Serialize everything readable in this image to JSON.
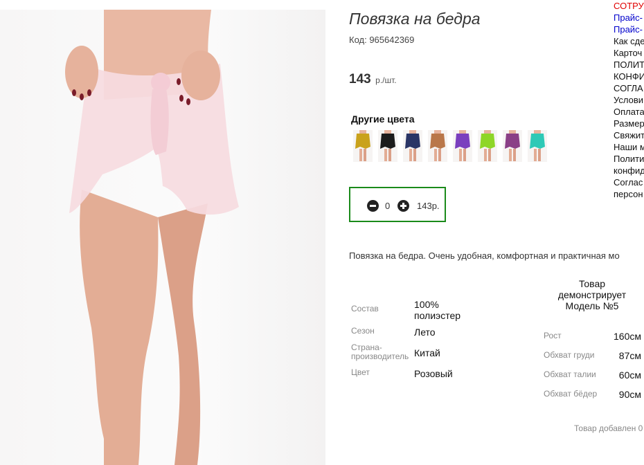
{
  "product": {
    "title": "Повязка на бедра",
    "code": "Код: 965642369",
    "price": "143",
    "price_unit": "р./шт.",
    "description": "Повязка на бедра. Очень удобная, комфортная и практичная мо"
  },
  "other_colors": {
    "title": "Другие цвета",
    "swatches": [
      {
        "name": "yellow",
        "color": "#c9a21c"
      },
      {
        "name": "black",
        "color": "#1c1c1c"
      },
      {
        "name": "navy",
        "color": "#2a3566"
      },
      {
        "name": "bronze",
        "color": "#b9774a"
      },
      {
        "name": "violet",
        "color": "#7a3fbe"
      },
      {
        "name": "lime",
        "color": "#8ed628"
      },
      {
        "name": "purple",
        "color": "#8a3f86"
      },
      {
        "name": "turquoise",
        "color": "#2ec9b6"
      }
    ]
  },
  "quantity": {
    "value": "0",
    "sum": "143р.",
    "minus_icon": "minus-circle-icon",
    "plus_icon": "plus-circle-icon",
    "border_color": "#1a8a1a"
  },
  "properties": [
    {
      "label": "Состав",
      "value": "100% полиэстер"
    },
    {
      "label": "Сезон",
      "value": "Лето"
    },
    {
      "label": "Страна-производитель",
      "value": "Китай"
    },
    {
      "label": "Цвет",
      "value": "Розовый"
    }
  ],
  "model": {
    "heading": "Товар демонстрирует Модель №5",
    "rows": [
      {
        "label": "Рост",
        "value": "160см"
      },
      {
        "label": "Обхват груди",
        "value": "87см"
      },
      {
        "label": "Обхват талии",
        "value": "60см"
      },
      {
        "label": "Обхват бёдер",
        "value": "90см"
      }
    ]
  },
  "added_note": "Товар добавлен 0",
  "side_links": [
    {
      "text": "СОТРУ",
      "color": "#e00000"
    },
    {
      "text": "Прайс-",
      "color": "#0000cc"
    },
    {
      "text": "Прайс-",
      "color": "#0000cc"
    },
    {
      "text": "Как сде",
      "color": "#111111"
    },
    {
      "text": "Карточ",
      "color": "#111111"
    },
    {
      "text": "ПОЛИТ",
      "color": "#111111"
    },
    {
      "text": "КОНФИ",
      "color": "#111111"
    },
    {
      "text": "СОГЛА",
      "color": "#111111"
    },
    {
      "text": "Услови",
      "color": "#111111"
    },
    {
      "text": "Оплата",
      "color": "#111111"
    },
    {
      "text": "Размер",
      "color": "#111111"
    },
    {
      "text": "Свяжит",
      "color": "#111111"
    },
    {
      "text": "Наши м",
      "color": "#111111"
    },
    {
      "text": "Полити",
      "color": "#111111"
    },
    {
      "text": "конфид",
      "color": "#111111"
    },
    {
      "text": "Соглас",
      "color": "#111111"
    },
    {
      "text": "персон",
      "color": "#111111"
    }
  ]
}
